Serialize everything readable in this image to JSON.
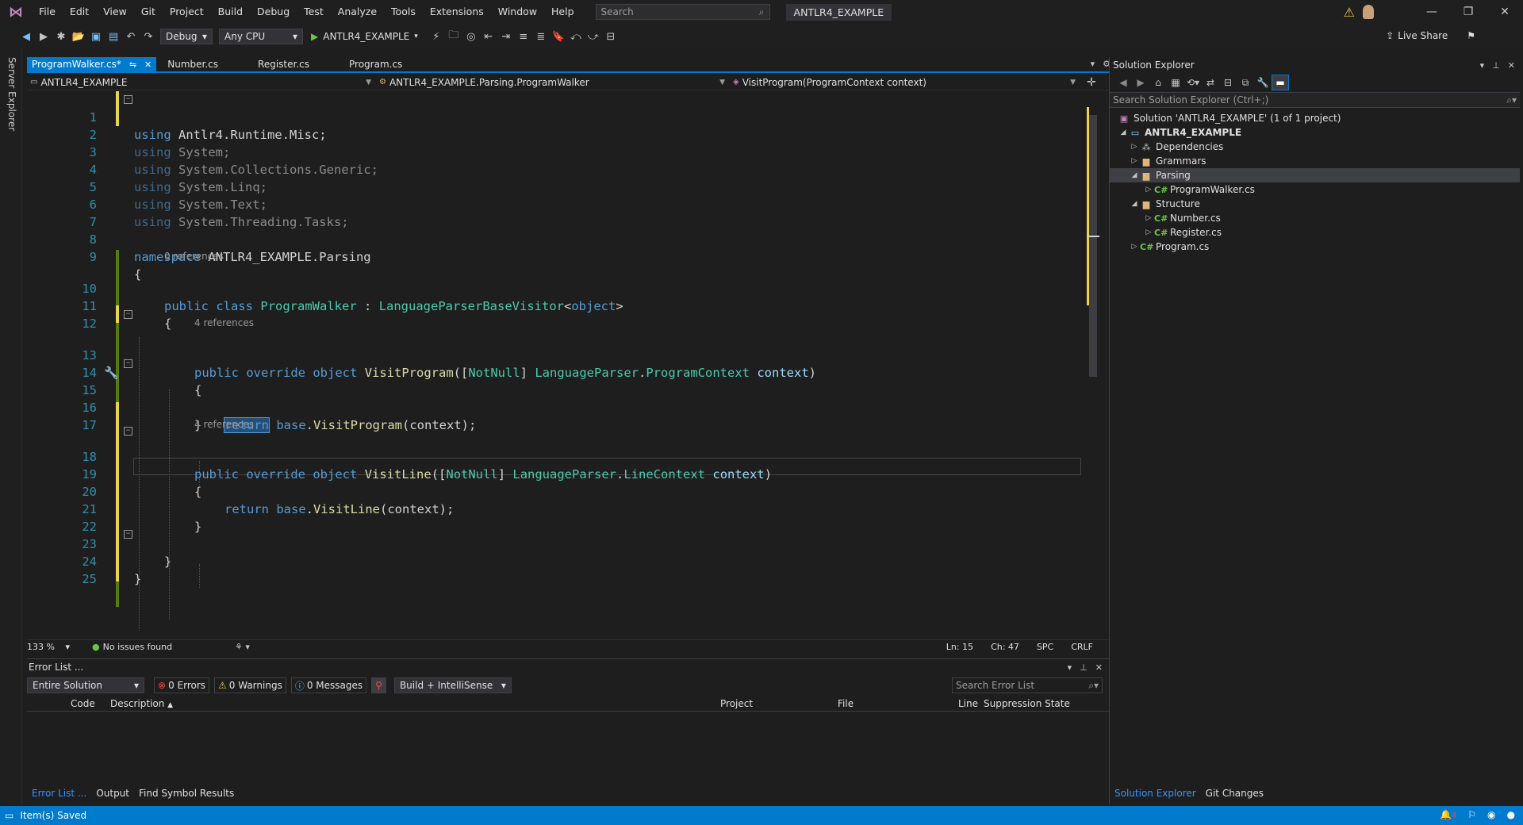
{
  "menu": [
    "File",
    "Edit",
    "View",
    "Git",
    "Project",
    "Build",
    "Debug",
    "Test",
    "Analyze",
    "Tools",
    "Extensions",
    "Window",
    "Help"
  ],
  "search": {
    "placeholder": "Search"
  },
  "solution_title": "ANTLR4_EXAMPLE",
  "toolbar": {
    "config": "Debug",
    "platform": "Any CPU",
    "start_target": "ANTLR4_EXAMPLE",
    "live_share": "Live Share"
  },
  "left_strip": {
    "server_explorer": "Server Explorer"
  },
  "tabs": [
    {
      "label": "ProgramWalker.cs*",
      "active": true
    },
    {
      "label": "Number.cs"
    },
    {
      "label": "Register.cs"
    },
    {
      "label": "Program.cs"
    }
  ],
  "navbar": {
    "project": "ANTLR4_EXAMPLE",
    "type": "ANTLR4_EXAMPLE.Parsing.ProgramWalker",
    "member": "VisitProgram(ProgramContext context)"
  },
  "editor": {
    "line_numbers": [
      "1",
      "2",
      "3",
      "4",
      "5",
      "6",
      "7",
      "8",
      "9",
      "10",
      "11",
      "12",
      "13",
      "14",
      "15",
      "16",
      "17",
      "18",
      "19",
      "20",
      "21",
      "22",
      "23",
      "24",
      "25"
    ],
    "code": {
      "l1_kw": "using",
      "l1_ns": " Antlr4.Runtime.Misc;",
      "l2_kw": "using",
      "l2_ns": " System;",
      "l3_kw": "using",
      "l3_ns": " System.Collections.Generic;",
      "l4_kw": "using",
      "l4_ns": " System.Linq;",
      "l5_kw": "using",
      "l5_ns": " System.Text;",
      "l6_kw": "using",
      "l6_ns": " System.Threading.Tasks;",
      "l8_kw": "namespace",
      "l8_ns": " ANTLR4_EXAMPLE.Parsing",
      "open_brace": "{",
      "close_brace": "}",
      "l10_public": "public",
      "l10_class": "class",
      "l10_name": "ProgramWalker",
      "l10_colon": " : ",
      "l10_base": "LanguageParserBaseVisitor",
      "l10_lt": "<",
      "l10_obj": "object",
      "l10_gt": ">",
      "public": "public",
      "override": "override",
      "object": "object",
      "l13_fn": "VisitProgram",
      "l13_p1": "([",
      "l13_attr": "NotNull",
      "l13_p2": "] ",
      "l13_t1": "LanguageParser",
      "l13_dot": ".",
      "l13_t2": "ProgramContext",
      "l13_sp": " ",
      "l13_arg": "context",
      "l13_close": ")",
      "return": "return",
      "base": "base",
      "dot": ".",
      "l15_fn": "VisitProgram",
      "l15_args": "(context);",
      "l18_fn": "VisitLine",
      "l18_p1": "([",
      "l18_attr": "NotNull",
      "l18_p2": "] ",
      "l18_t1": "LanguageParser",
      "l18_dot": ".",
      "l18_t2": "LineContext",
      "l18_sp": " ",
      "l18_arg": "context",
      "l18_close": ")",
      "l20_fn": "VisitLine",
      "l20_args": "(context);"
    },
    "hints": {
      "class_refs": "0 references",
      "program_refs": "4 references",
      "line_refs": "4 references"
    }
  },
  "editor_status": {
    "zoom": "133 %",
    "issues": "No issues found",
    "ln": "Ln: 15",
    "ch": "Ch: 47",
    "spc": "SPC",
    "crlf": "CRLF"
  },
  "error_list": {
    "title": "Error List ...",
    "scope": "Entire Solution",
    "errors": "0 Errors",
    "warnings": "0 Warnings",
    "messages": "0 Messages",
    "build_filter": "Build + IntelliSense",
    "search_placeholder": "Search Error List",
    "columns": {
      "code": "Code",
      "description": "Description",
      "project": "Project",
      "file": "File",
      "line": "Line",
      "suppression": "Suppression State"
    }
  },
  "bottom_tabs": [
    "Error List ...",
    "Output",
    "Find Symbol Results"
  ],
  "solution_explorer": {
    "title": "Solution Explorer",
    "search_placeholder": "Search Solution Explorer (Ctrl+;)",
    "tree": {
      "solution": "Solution 'ANTLR4_EXAMPLE' (1 of 1 project)",
      "project": "ANTLR4_EXAMPLE",
      "dependencies": "Dependencies",
      "grammars": "Grammars",
      "parsing": "Parsing",
      "program_walker": "ProgramWalker.cs",
      "structure": "Structure",
      "number": "Number.cs",
      "register": "Register.cs",
      "program": "Program.cs"
    },
    "bottom_tabs": [
      "Solution Explorer",
      "Git Changes"
    ]
  },
  "statusbar": {
    "text": "Item(s) Saved",
    "notifications": "4"
  },
  "colors": {
    "accent": "#007acc",
    "keyword": "#569cd6",
    "type": "#4ec9b0",
    "method": "#dcdcaa",
    "parameter": "#9cdcfe",
    "line_number": "#2b91af",
    "change_saved": "#587c0c",
    "change_unsaved": "#e8d44d"
  }
}
